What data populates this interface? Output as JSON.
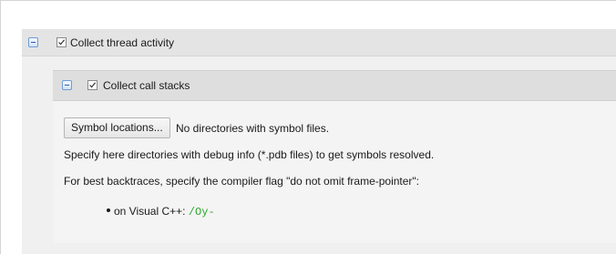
{
  "outer_section": {
    "label": "Collect thread activity",
    "checked": true,
    "expanded": true
  },
  "inner_section": {
    "label": "Collect call stacks",
    "checked": true,
    "expanded": true
  },
  "symbols": {
    "button_label": "Symbol locations...",
    "status": "No directories with symbol files."
  },
  "info": {
    "line1": "Specify here directories with debug info (*.pdb files) to get symbols resolved.",
    "line2": "For best backtraces, specify the compiler flag \"do not omit frame-pointer\":"
  },
  "bullets": [
    {
      "prefix": "on Visual C++: ",
      "code": "/Oy-"
    }
  ],
  "colors": {
    "code": "#2fa62f",
    "outer_header_bg": "#e4e4e4",
    "inner_header_bg": "#dedede",
    "panel_bg": "#f4f4f4"
  }
}
